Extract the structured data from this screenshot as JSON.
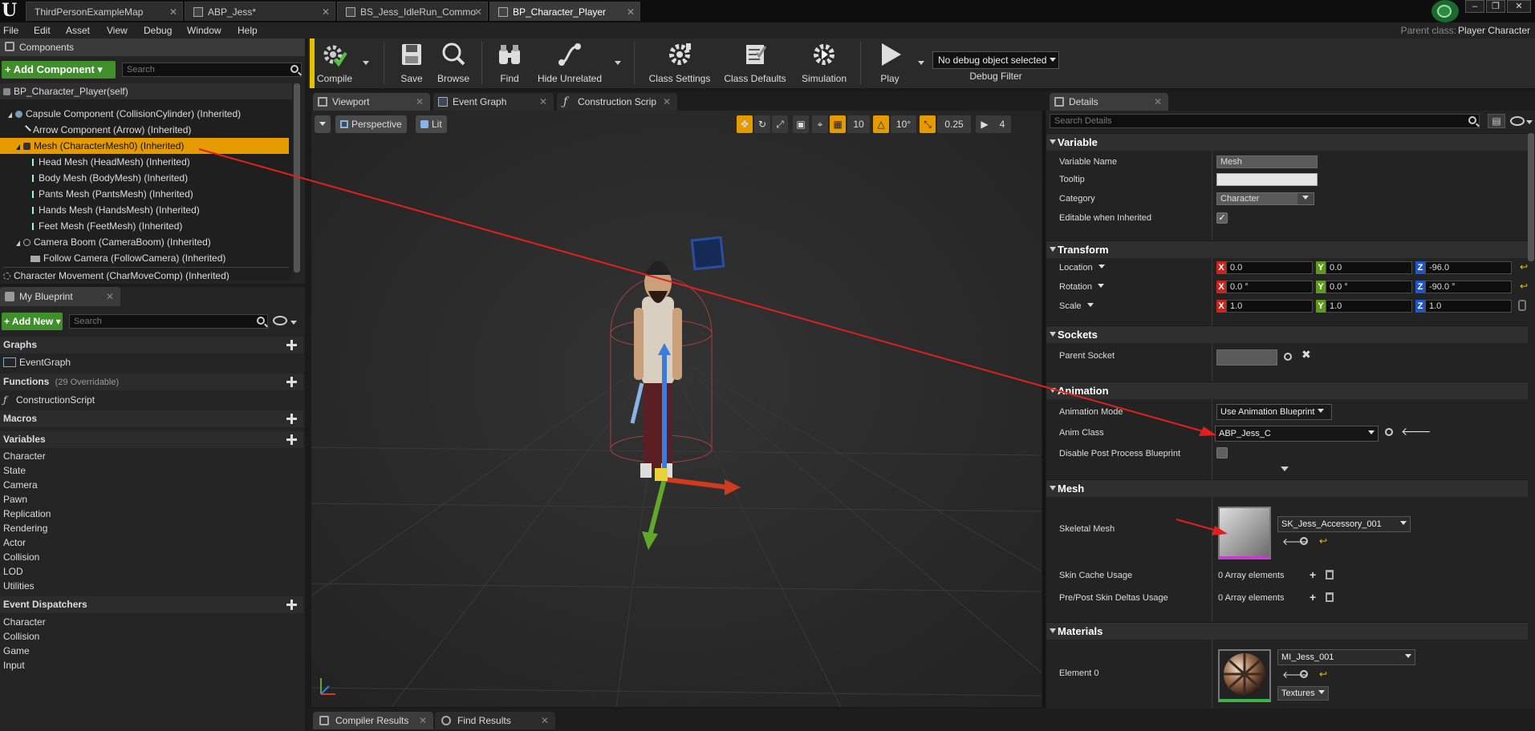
{
  "tabs": [
    {
      "label": "ThirdPersonExampleMap"
    },
    {
      "label": "ABP_Jess*"
    },
    {
      "label": "BS_Jess_IdleRun_Commo"
    },
    {
      "label": "BP_Character_Player"
    }
  ],
  "window_controls": [
    "–",
    "❐",
    "✕"
  ],
  "menu": [
    "File",
    "Edit",
    "Asset",
    "View",
    "Debug",
    "Window",
    "Help"
  ],
  "parent_class": {
    "label": "Parent class:",
    "value": "Player Character"
  },
  "components": {
    "title": "Components",
    "add_button": "+ Add Component ▾",
    "search_placeholder": "Search",
    "self_item": "BP_Character_Player(self)",
    "items": [
      "Capsule Component (CollisionCylinder) (Inherited)",
      "Arrow Component (Arrow) (Inherited)",
      "Mesh (CharacterMesh0) (Inherited)",
      "Head Mesh (HeadMesh) (Inherited)",
      "Body Mesh (BodyMesh) (Inherited)",
      "Pants Mesh (PantsMesh) (Inherited)",
      "Hands Mesh (HandsMesh) (Inherited)",
      "Feet Mesh (FeetMesh) (Inherited)",
      "Camera Boom (CameraBoom) (Inherited)",
      "Follow Camera (FollowCamera) (Inherited)",
      "Character Movement (CharMoveComp) (Inherited)"
    ]
  },
  "my_blueprint": {
    "title": "My Blueprint",
    "add_button": "+ Add New ▾",
    "search_placeholder": "Search",
    "graphs": "Graphs",
    "event_graph": "EventGraph",
    "functions": "Functions",
    "functions_note": "(29 Overridable)",
    "construction_script": "ConstructionScript",
    "macros": "Macros",
    "variables": "Variables",
    "variable_items": [
      "Character",
      "State",
      "Camera",
      "Pawn",
      "Replication",
      "Rendering",
      "Actor",
      "Collision",
      "LOD",
      "Utilities"
    ],
    "event_dispatchers": "Event Dispatchers",
    "dispatcher_items": [
      "Character",
      "Collision",
      "Game",
      "Input"
    ]
  },
  "toolbar": {
    "compile": "Compile",
    "save": "Save",
    "browse": "Browse",
    "find": "Find",
    "hide_unrelated": "Hide Unrelated",
    "class_settings": "Class Settings",
    "class_defaults": "Class Defaults",
    "simulation": "Simulation",
    "play": "Play",
    "debug_object": "No debug object selected",
    "debug_filter": "Debug Filter"
  },
  "editor_tabs": [
    {
      "label": "Viewport"
    },
    {
      "label": "Event Graph"
    },
    {
      "label": "Construction Scrip"
    }
  ],
  "viewport": {
    "perspective": "Perspective",
    "lit": "Lit",
    "grid_snap": "10",
    "rotation_snap": "10°",
    "scale_snap": "0.25",
    "camera_speed": "4"
  },
  "details": {
    "title": "Details",
    "search_placeholder": "Search Details",
    "variable": {
      "section": "Variable",
      "name_label": "Variable Name",
      "name_value": "Mesh",
      "tooltip_label": "Tooltip",
      "tooltip_value": "",
      "category_label": "Category",
      "category_value": "Character",
      "editable_label": "Editable when Inherited"
    },
    "transform": {
      "section": "Transform",
      "location_label": "Location",
      "rotation_label": "Rotation",
      "scale_label": "Scale",
      "location": [
        "0.0",
        "0.0",
        "-96.0"
      ],
      "rotation": [
        "0.0 °",
        "0.0 °",
        "-90.0 °"
      ],
      "scale": [
        "1.0",
        "1.0",
        "1.0"
      ]
    },
    "sockets": {
      "section": "Sockets",
      "parent_socket_label": "Parent Socket"
    },
    "animation": {
      "section": "Animation",
      "mode_label": "Animation Mode",
      "mode_value": "Use Animation Blueprint",
      "anim_class_label": "Anim Class",
      "anim_class_value": "ABP_Jess_C",
      "disable_pp_label": "Disable Post Process Blueprint"
    },
    "mesh": {
      "section": "Mesh",
      "skeletal_label": "Skeletal Mesh",
      "skeletal_value": "SK_Jess_Accessory_001",
      "skin_cache_label": "Skin Cache Usage",
      "skin_cache_value": "0 Array elements",
      "prepost_label": "Pre/Post Skin Deltas Usage",
      "prepost_value": "0 Array elements"
    },
    "materials": {
      "section": "Materials",
      "element0_label": "Element 0",
      "element0_value": "MI_Jess_001",
      "textures": "Textures"
    }
  },
  "bottom_tabs": [
    {
      "label": "Compiler Results"
    },
    {
      "label": "Find Results"
    }
  ],
  "colors": {
    "selection": "#e59a00",
    "add_green": "#3f8f2b",
    "annotation_red": "#e02020",
    "axis_x": "#c8261c",
    "axis_y": "#5d9a1c",
    "axis_z": "#1f56c8"
  }
}
